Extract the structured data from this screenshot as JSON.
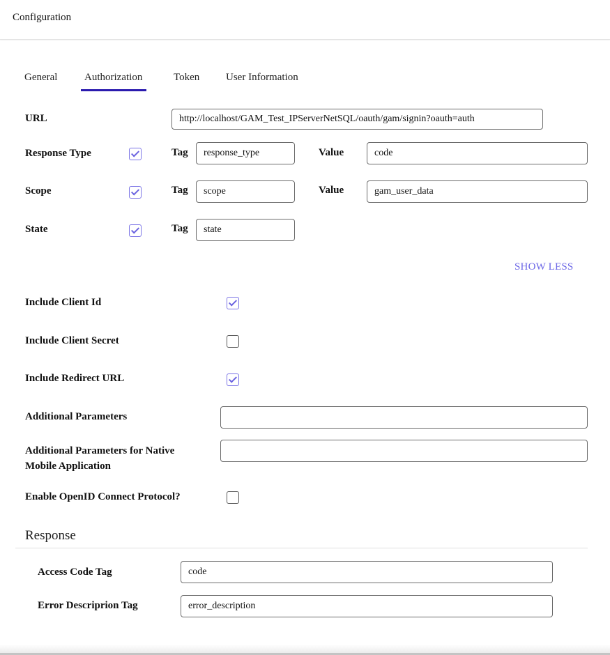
{
  "header": {
    "title": "Configuration"
  },
  "tabs": [
    {
      "label": "General",
      "active": false
    },
    {
      "label": "Authorization",
      "active": true
    },
    {
      "label": "Token",
      "active": false
    },
    {
      "label": "User Information",
      "active": false
    }
  ],
  "colors": {
    "accent": "#2a1aae",
    "link": "#6b66e6",
    "checkbox": "#7b74e6"
  },
  "form": {
    "url": {
      "label": "URL",
      "value": "http://localhost/GAM_Test_IPServerNetSQL/oauth/gam/signin?oauth=auth"
    },
    "response_type": {
      "label": "Response Type",
      "checked": true,
      "tag_label": "Tag",
      "tag_value": "response_type",
      "value_label": "Value",
      "value": "code"
    },
    "scope": {
      "label": "Scope",
      "checked": true,
      "tag_label": "Tag",
      "tag_value": "scope",
      "value_label": "Value",
      "value": "gam_user_data"
    },
    "state": {
      "label": "State",
      "checked": true,
      "tag_label": "Tag",
      "tag_value": "state"
    },
    "show_less": "SHOW LESS",
    "include_client_id": {
      "label": "Include Client Id",
      "checked": true
    },
    "include_client_secret": {
      "label": "Include Client Secret",
      "checked": false
    },
    "include_redirect_url": {
      "label": "Include Redirect URL",
      "checked": true
    },
    "additional_parameters": {
      "label": "Additional Parameters",
      "value": ""
    },
    "additional_parameters_native": {
      "label": "Additional Parameters for Native Mobile Application",
      "value": ""
    },
    "enable_openid": {
      "label": "Enable OpenID Connect Protocol?",
      "checked": false
    }
  },
  "response": {
    "title": "Response",
    "access_code_tag": {
      "label": "Access Code Tag",
      "value": "code"
    },
    "error_description_tag": {
      "label": "Error Descriprion Tag",
      "value": "error_description"
    }
  }
}
